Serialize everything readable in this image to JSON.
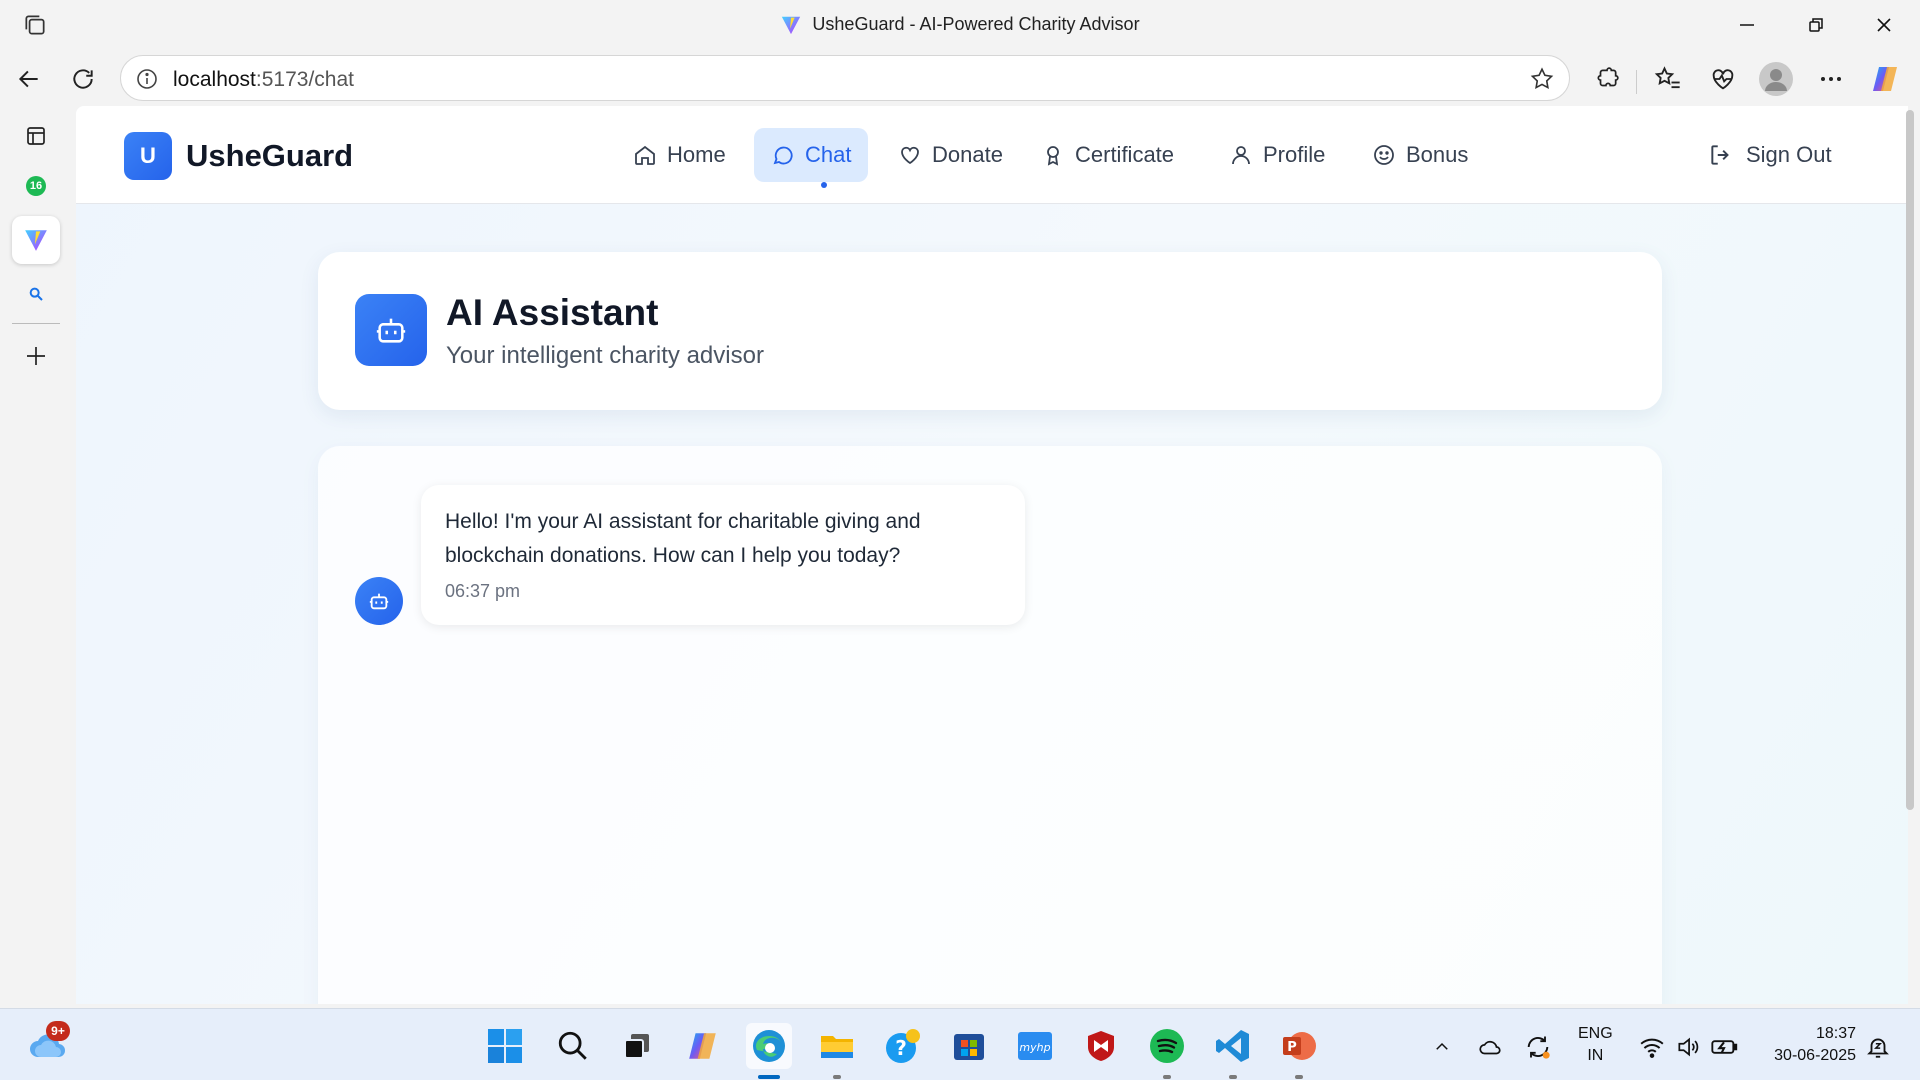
{
  "browser": {
    "window_title": "UsheGuard - AI-Powered Charity Advisor",
    "url_host": "localhost",
    "url_path": ":5173/chat",
    "tab_badge": "16"
  },
  "header": {
    "logo_letter": "U",
    "brand": "UsheGuard",
    "nav": [
      {
        "label": "Home",
        "icon": "home-icon"
      },
      {
        "label": "Chat",
        "icon": "chat-icon",
        "active": true
      },
      {
        "label": "Donate",
        "icon": "heart-icon"
      },
      {
        "label": "Certificate",
        "icon": "award-icon"
      },
      {
        "label": "Profile",
        "icon": "user-icon"
      },
      {
        "label": "Bonus",
        "icon": "smile-icon"
      }
    ],
    "sign_out": "Sign Out"
  },
  "assistant": {
    "title": "AI Assistant",
    "subtitle": "Your intelligent charity advisor",
    "icon": "bot-icon"
  },
  "chat": {
    "messages": [
      {
        "sender": "bot",
        "text": "Hello! I'm your AI assistant for charitable giving and blockchain donations. How can I help you today?",
        "time": "06:37 pm"
      }
    ]
  },
  "taskbar": {
    "weather_badge": "9+",
    "lang_line1": "ENG",
    "lang_line2": "IN",
    "time": "18:37",
    "date": "30-06-2025"
  },
  "colors": {
    "accent": "#2563eb",
    "accent_light": "#dbeafe",
    "page_bg": "#f0f6fd"
  }
}
